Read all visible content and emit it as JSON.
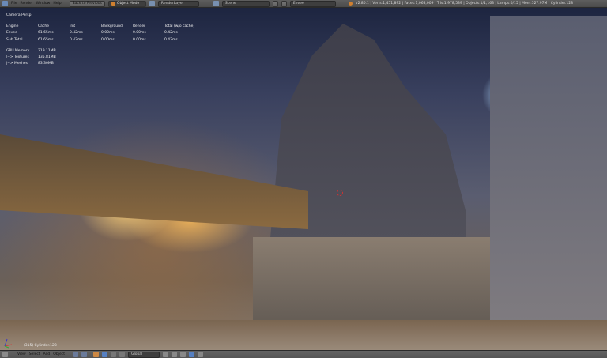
{
  "topbar": {
    "menus": [
      "File",
      "Render",
      "Window",
      "Help"
    ],
    "back_button": "Back to Previous",
    "mode": "Object Mode",
    "render_layer": "RenderLayer",
    "scene": "Scene",
    "engine": "Eevee",
    "stats": "v2.80.1 | Verts:1,451,892 | Faces:1,068,009 | Tris:1,978,539 | Objects:1/1,163 | Lamps:0/15 | Mem:527.97M | Cylinder.128"
  },
  "overlay": {
    "view": "Camera Persp",
    "headers": [
      "Engine",
      "Cache",
      "Init",
      "Background",
      "Render",
      "Total (w/o cache)"
    ],
    "rows": [
      [
        "Eevee",
        "61.65ms",
        "0.42ms",
        "0.00ms",
        "0.00ms",
        "0.42ms"
      ],
      [
        "Sub Total",
        "61.65ms",
        "0.42ms",
        "0.00ms",
        "0.00ms",
        "0.42ms"
      ]
    ],
    "memory": [
      [
        "GPU Memory",
        "219.11MB"
      ],
      [
        "|--> Textures",
        "135.81MB"
      ],
      [
        "|--> Meshes",
        "83.30MB"
      ]
    ]
  },
  "viewport": {
    "object_name": "(315) Cylinder.128"
  },
  "bottombar": {
    "menus": [
      "View",
      "Select",
      "Add",
      "Object"
    ],
    "orientation": "Global"
  }
}
